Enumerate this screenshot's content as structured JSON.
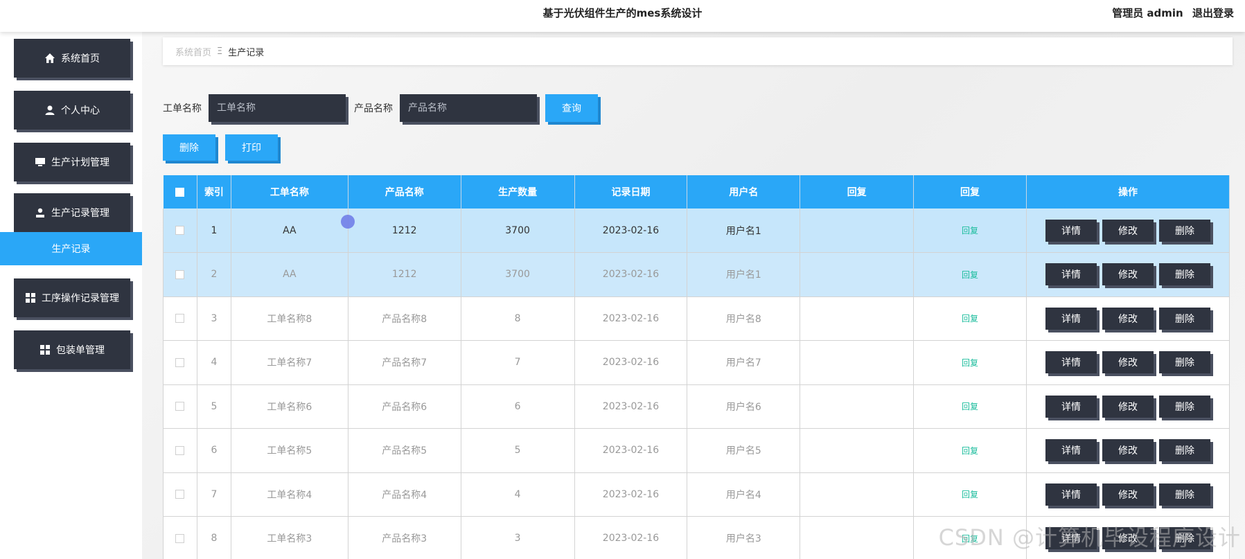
{
  "header": {
    "title": "基于光伏组件生产的mes系统设计",
    "user_label": "管理员 admin",
    "logout": "退出登录"
  },
  "sidebar": {
    "items": [
      {
        "label": "系统首页",
        "icon": "home-icon"
      },
      {
        "label": "个人中心",
        "icon": "user-icon"
      },
      {
        "label": "生产计划管理",
        "icon": "monitor-icon"
      },
      {
        "label": "生产记录管理",
        "icon": "person-icon"
      },
      {
        "label": "工序操作记录管理",
        "icon": "grid-icon"
      },
      {
        "label": "包装单管理",
        "icon": "grid-icon"
      }
    ],
    "sub_item": "生产记录"
  },
  "breadcrumb": {
    "home": "系统首页",
    "separator": "Ξ",
    "current": "生产记录"
  },
  "search": {
    "order_label": "工单名称",
    "order_placeholder": "工单名称",
    "product_label": "产品名称",
    "product_placeholder": "产品名称",
    "query_button": "查询"
  },
  "actions": {
    "delete": "删除",
    "print": "打印"
  },
  "table": {
    "headers": [
      "索引",
      "工单名称",
      "产品名称",
      "生产数量",
      "记录日期",
      "用户名",
      "回复",
      "回复",
      "操作"
    ],
    "reply_link": "回复",
    "op_detail": "详情",
    "op_edit": "修改",
    "op_delete": "删除",
    "rows": [
      {
        "idx": "1",
        "order": "AA",
        "product": "1212",
        "qty": "3700",
        "date": "2023-02-16",
        "user": "用户名1",
        "reply": ""
      },
      {
        "idx": "2",
        "order": "AA",
        "product": "1212",
        "qty": "3700",
        "date": "2023-02-16",
        "user": "用户名1",
        "reply": ""
      },
      {
        "idx": "3",
        "order": "工单名称8",
        "product": "产品名称8",
        "qty": "8",
        "date": "2023-02-16",
        "user": "用户名8",
        "reply": ""
      },
      {
        "idx": "4",
        "order": "工单名称7",
        "product": "产品名称7",
        "qty": "7",
        "date": "2023-02-16",
        "user": "用户名7",
        "reply": ""
      },
      {
        "idx": "5",
        "order": "工单名称6",
        "product": "产品名称6",
        "qty": "6",
        "date": "2023-02-16",
        "user": "用户名6",
        "reply": ""
      },
      {
        "idx": "6",
        "order": "工单名称5",
        "product": "产品名称5",
        "qty": "5",
        "date": "2023-02-16",
        "user": "用户名5",
        "reply": ""
      },
      {
        "idx": "7",
        "order": "工单名称4",
        "product": "产品名称4",
        "qty": "4",
        "date": "2023-02-16",
        "user": "用户名4",
        "reply": ""
      },
      {
        "idx": "8",
        "order": "工单名称3",
        "product": "产品名称3",
        "qty": "3",
        "date": "2023-02-16",
        "user": "用户名3",
        "reply": ""
      }
    ]
  },
  "watermark": "CSDN @计算机毕设程序设计"
}
